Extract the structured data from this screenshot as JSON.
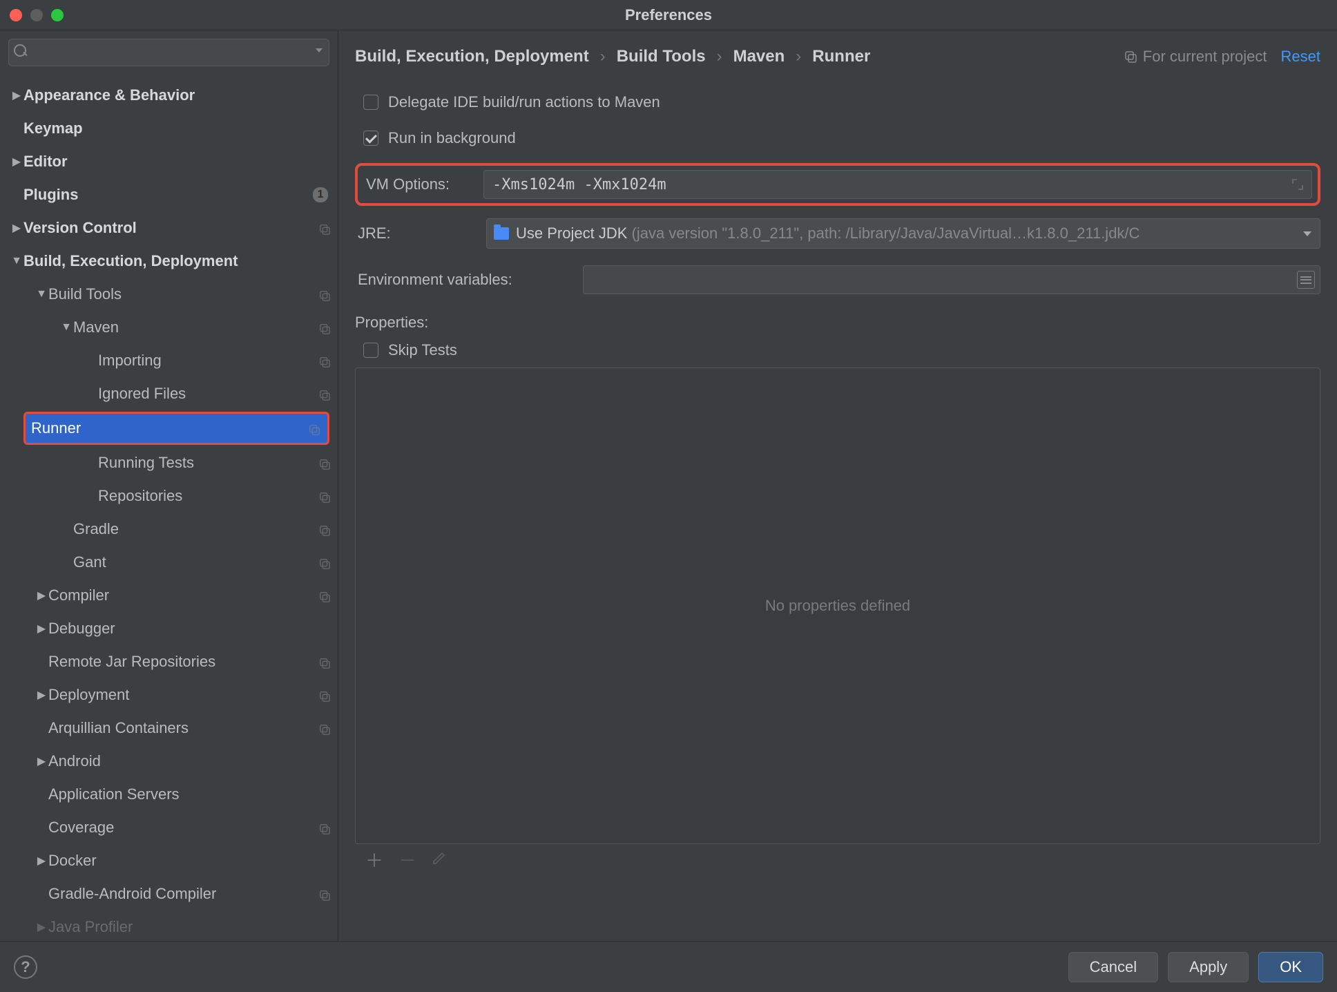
{
  "title": "Preferences",
  "search_placeholder": "",
  "breadcrumbs": [
    "Build, Execution, Deployment",
    "Build Tools",
    "Maven",
    "Runner"
  ],
  "scope_label": "For current project",
  "reset_label": "Reset",
  "checkboxes": {
    "delegate": {
      "label": "Delegate IDE build/run actions to Maven",
      "checked": false
    },
    "runbg": {
      "label": "Run in background",
      "checked": true
    }
  },
  "fields": {
    "vm_label": "VM Options:",
    "vm_value": "-Xms1024m -Xmx1024m",
    "jre_label": "JRE:",
    "jre_selected_main": "Use Project JDK",
    "jre_selected_detail": "(java version \"1.8.0_211\", path: /Library/Java/JavaVirtual…k1.8.0_211.jdk/C",
    "env_label": "Environment variables:",
    "env_value": ""
  },
  "properties": {
    "header": "Properties:",
    "skip_tests_label": "Skip Tests",
    "skip_tests_checked": false,
    "empty_text": "No properties defined"
  },
  "tree": [
    {
      "label": "Appearance & Behavior",
      "indent": 0,
      "arrow": "right",
      "bold": true
    },
    {
      "label": "Keymap",
      "indent": 0,
      "arrow": "",
      "bold": true
    },
    {
      "label": "Editor",
      "indent": 0,
      "arrow": "right",
      "bold": true
    },
    {
      "label": "Plugins",
      "indent": 0,
      "arrow": "",
      "bold": true,
      "badge": "1"
    },
    {
      "label": "Version Control",
      "indent": 0,
      "arrow": "right",
      "bold": true,
      "copy": true
    },
    {
      "label": "Build, Execution, Deployment",
      "indent": 0,
      "arrow": "down",
      "bold": true
    },
    {
      "label": "Build Tools",
      "indent": 1,
      "arrow": "down",
      "copy": true
    },
    {
      "label": "Maven",
      "indent": 2,
      "arrow": "down",
      "copy": true
    },
    {
      "label": "Importing",
      "indent": 3,
      "arrow": "",
      "copy": true
    },
    {
      "label": "Ignored Files",
      "indent": 3,
      "arrow": "",
      "copy": true
    },
    {
      "label": "Runner",
      "indent": 3,
      "arrow": "",
      "copy": true,
      "selected": true
    },
    {
      "label": "Running Tests",
      "indent": 3,
      "arrow": "",
      "copy": true
    },
    {
      "label": "Repositories",
      "indent": 3,
      "arrow": "",
      "copy": true
    },
    {
      "label": "Gradle",
      "indent": 2,
      "arrow": "",
      "copy": true
    },
    {
      "label": "Gant",
      "indent": 2,
      "arrow": "",
      "copy": true
    },
    {
      "label": "Compiler",
      "indent": 1,
      "arrow": "right",
      "copy": true
    },
    {
      "label": "Debugger",
      "indent": 1,
      "arrow": "right"
    },
    {
      "label": "Remote Jar Repositories",
      "indent": 1,
      "arrow": "",
      "copy": true
    },
    {
      "label": "Deployment",
      "indent": 1,
      "arrow": "right",
      "copy": true
    },
    {
      "label": "Arquillian Containers",
      "indent": 1,
      "arrow": "",
      "copy": true
    },
    {
      "label": "Android",
      "indent": 1,
      "arrow": "right"
    },
    {
      "label": "Application Servers",
      "indent": 1,
      "arrow": ""
    },
    {
      "label": "Coverage",
      "indent": 1,
      "arrow": "",
      "copy": true
    },
    {
      "label": "Docker",
      "indent": 1,
      "arrow": "right"
    },
    {
      "label": "Gradle-Android Compiler",
      "indent": 1,
      "arrow": "",
      "copy": true
    },
    {
      "label": "Java Profiler",
      "indent": 1,
      "arrow": "right",
      "faded": true
    }
  ],
  "buttons": {
    "cancel": "Cancel",
    "apply": "Apply",
    "ok": "OK"
  }
}
